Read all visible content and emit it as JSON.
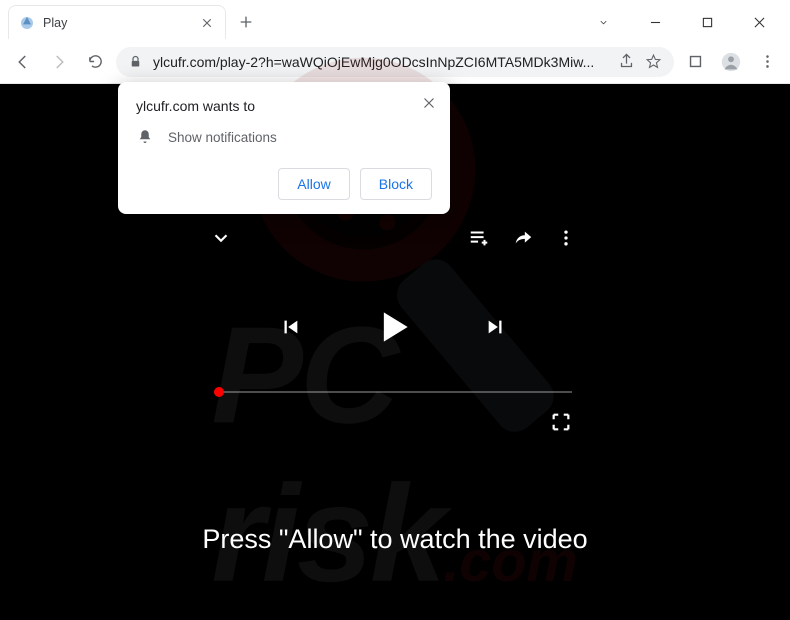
{
  "window": {
    "tab_title": "Play",
    "url_display": "ylcufr.com/play-2?h=waWQiOjEwMjg0ODcsInNpZCI6MTA5MDk3Miw..."
  },
  "permission": {
    "origin_text": "ylcufr.com wants to",
    "item_label": "Show notifications",
    "allow_label": "Allow",
    "block_label": "Block"
  },
  "page": {
    "caption": "Press \"Allow\" to watch the video"
  },
  "watermark": {
    "brand_main": "PC",
    "brand_sub": "risk",
    "brand_tld": ".com"
  }
}
